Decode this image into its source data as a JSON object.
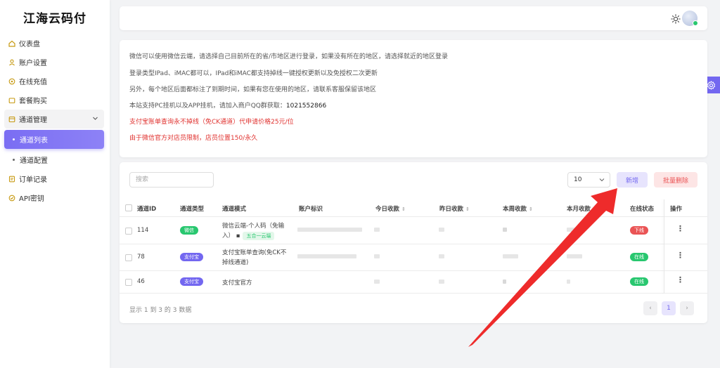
{
  "brand": "江海云码付",
  "sidebar": {
    "items": [
      {
        "label": "仪表盘",
        "icon": "home-icon"
      },
      {
        "label": "账户设置",
        "icon": "user-icon"
      },
      {
        "label": "在线充值",
        "icon": "coin-icon"
      },
      {
        "label": "套餐购买",
        "icon": "cart-icon"
      },
      {
        "label": "通道管理",
        "icon": "channel-icon"
      },
      {
        "label": "通道列表",
        "icon": "dot-icon"
      },
      {
        "label": "通道配置",
        "icon": "dot-icon"
      },
      {
        "label": "订单记录",
        "icon": "order-icon"
      },
      {
        "label": "API密钥",
        "icon": "key-icon"
      }
    ],
    "active": "通道列表"
  },
  "notice": {
    "line1": "微信可以使用微信云端，请选择自己目前所在的省/市地区进行登录，如果没有所在的地区，请选择就近的地区登录",
    "line2": "登录类型IPad、iMAC都可以，IPad和iMAC都支持掉线一键授权更新以及免授权二次更新",
    "line3": "另外，每个地区后面都标注了到期时间，如果有您在使用的地区，请联系客服保留该地区",
    "line4_text": "本站支持PC挂机以及APP挂机，请加入商户QQ群获取：",
    "line4_qq": "1021552866",
    "line5": "支付宝账单查询永不掉线（免CK通道）代申请价格25元/位",
    "line6": "由于微信官方对店员限制，店员位置150/永久"
  },
  "toolbar": {
    "search_placeholder": "搜索",
    "page_size": "10",
    "add_label": "新增",
    "batch_delete_label": "批量删除"
  },
  "table": {
    "headers": {
      "id": "通道ID",
      "type": "通道类型",
      "mode": "通道模式",
      "account": "账户标识",
      "today": "今日收款",
      "yesterday": "昨日收款",
      "week": "本周收款",
      "month": "本月收款",
      "status": "在线状态",
      "actions": "操作"
    },
    "rows": [
      {
        "id": "114",
        "type": "微信",
        "mode1": "微信云端-个人码（免输",
        "mode2": "入）",
        "mode_tag": "五合一云端",
        "status": "下线"
      },
      {
        "id": "78",
        "type": "支付宝",
        "mode1": "支付宝账单查询(免CK不",
        "mode2": "掉线通道)",
        "status": "在线"
      },
      {
        "id": "46",
        "type": "支付宝",
        "mode1": "支付宝官方",
        "status": "在线"
      }
    ]
  },
  "footer": {
    "summary": "显示 1 到 3 的 3 数据",
    "prev": "‹",
    "current_page": "1",
    "next": "›"
  },
  "colors": {
    "primary": "#7367f0",
    "success": "#28c76f",
    "danger": "#ea5455"
  }
}
